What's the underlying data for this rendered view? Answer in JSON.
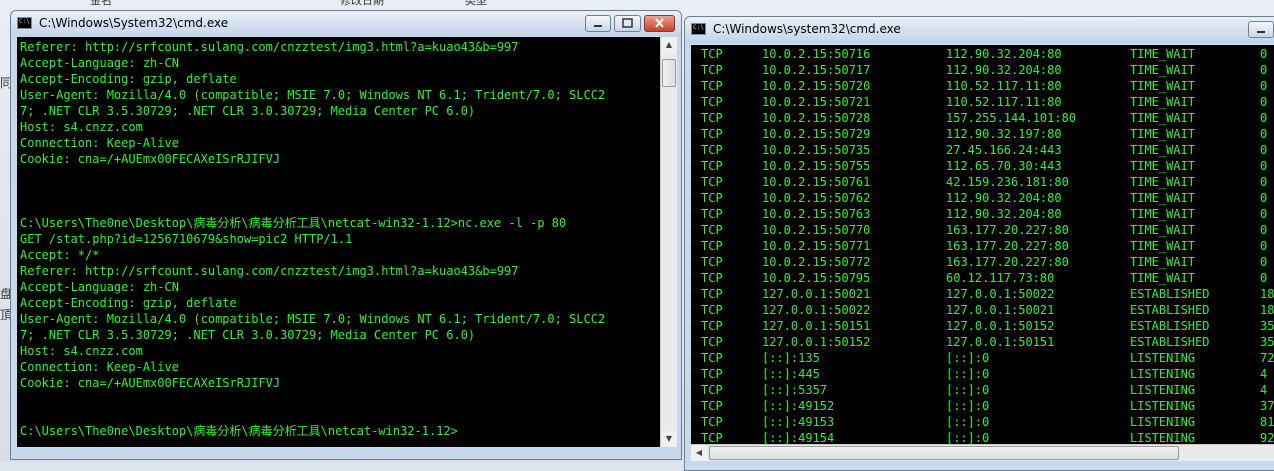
{
  "background": {
    "left_edge_chars": [
      "同",
      "盘",
      "頂"
    ],
    "top_fragments": [
      "金名",
      "修改日期",
      "类型"
    ]
  },
  "window_left": {
    "title": "C:\\Windows\\System32\\cmd.exe",
    "icon_label": "C:\\",
    "lines": [
      "Referer: http://srfcount.sulang.com/cnzztest/img3.html?a=kuao43&b=997",
      "Accept-Language: zh-CN",
      "Accept-Encoding: gzip, deflate",
      "User-Agent: Mozilla/4.0 (compatible; MSIE 7.0; Windows NT 6.1; Trident/7.0; SLCC2",
      "7; .NET CLR 3.5.30729; .NET CLR 3.0.30729; Media Center PC 6.0)",
      "Host: s4.cnzz.com",
      "Connection: Keep-Alive",
      "Cookie: cna=/+AUEmx00FECAXeISrRJIFVJ",
      "",
      "",
      "",
      "C:\\Users\\The0ne\\Desktop\\病毒分析\\病毒分析工具\\netcat-win32-1.12>nc.exe -l -p 80",
      "GET /stat.php?id=1256710679&show=pic2 HTTP/1.1",
      "Accept: */*",
      "Referer: http://srfcount.sulang.com/cnzztest/img3.html?a=kuao43&b=997",
      "Accept-Language: zh-CN",
      "Accept-Encoding: gzip, deflate",
      "User-Agent: Mozilla/4.0 (compatible; MSIE 7.0; Windows NT 6.1; Trident/7.0; SLCC2",
      "7; .NET CLR 3.5.30729; .NET CLR 3.0.30729; Media Center PC 6.0)",
      "Host: s4.cnzz.com",
      "Connection: Keep-Alive",
      "Cookie: cna=/+AUEmx00FECAXeISrRJIFVJ",
      "",
      "",
      "C:\\Users\\The0ne\\Desktop\\病毒分析\\病毒分析工具\\netcat-win32-1.12>"
    ]
  },
  "window_right": {
    "title": "C:\\Windows\\system32\\cmd.exe",
    "icon_label": "C:\\",
    "rows": [
      [
        "TCP",
        "10.0.2.15:50716",
        "112.90.32.204:80",
        "TIME_WAIT",
        "0"
      ],
      [
        "TCP",
        "10.0.2.15:50717",
        "112.90.32.204:80",
        "TIME_WAIT",
        "0"
      ],
      [
        "TCP",
        "10.0.2.15:50720",
        "110.52.117.11:80",
        "TIME_WAIT",
        "0"
      ],
      [
        "TCP",
        "10.0.2.15:50721",
        "110.52.117.11:80",
        "TIME_WAIT",
        "0"
      ],
      [
        "TCP",
        "10.0.2.15:50728",
        "157.255.144.101:80",
        "TIME_WAIT",
        "0"
      ],
      [
        "TCP",
        "10.0.2.15:50729",
        "112.90.32.197:80",
        "TIME_WAIT",
        "0"
      ],
      [
        "TCP",
        "10.0.2.15:50735",
        "27.45.166.24:443",
        "TIME_WAIT",
        "0"
      ],
      [
        "TCP",
        "10.0.2.15:50755",
        "112.65.70.30:443",
        "TIME_WAIT",
        "0"
      ],
      [
        "TCP",
        "10.0.2.15:50761",
        "42.159.236.181:80",
        "TIME_WAIT",
        "0"
      ],
      [
        "TCP",
        "10.0.2.15:50762",
        "112.90.32.204:80",
        "TIME_WAIT",
        "0"
      ],
      [
        "TCP",
        "10.0.2.15:50763",
        "112.90.32.204:80",
        "TIME_WAIT",
        "0"
      ],
      [
        "TCP",
        "10.0.2.15:50770",
        "163.177.20.227:80",
        "TIME_WAIT",
        "0"
      ],
      [
        "TCP",
        "10.0.2.15:50771",
        "163.177.20.227:80",
        "TIME_WAIT",
        "0"
      ],
      [
        "TCP",
        "10.0.2.15:50772",
        "163.177.20.227:80",
        "TIME_WAIT",
        "0"
      ],
      [
        "TCP",
        "10.0.2.15:50795",
        "60.12.117.73:80",
        "TIME_WAIT",
        "0"
      ],
      [
        "TCP",
        "127.0.0.1:50021",
        "127.0.0.1:50022",
        "ESTABLISHED",
        "18"
      ],
      [
        "TCP",
        "127.0.0.1:50022",
        "127.0.0.1:50021",
        "ESTABLISHED",
        "18"
      ],
      [
        "TCP",
        "127.0.0.1:50151",
        "127.0.0.1:50152",
        "ESTABLISHED",
        "35"
      ],
      [
        "TCP",
        "127.0.0.1:50152",
        "127.0.0.1:50151",
        "ESTABLISHED",
        "35"
      ],
      [
        "TCP",
        "[::]:135",
        "[::]:0",
        "LISTENING",
        "72"
      ],
      [
        "TCP",
        "[::]:445",
        "[::]:0",
        "LISTENING",
        "4"
      ],
      [
        "TCP",
        "[::]:5357",
        "[::]:0",
        "LISTENING",
        "4"
      ],
      [
        "TCP",
        "[::]:49152",
        "[::]:0",
        "LISTENING",
        "37"
      ],
      [
        "TCP",
        "[::]:49153",
        "[::]:0",
        "LISTENING",
        "81"
      ],
      [
        "TCP",
        "[::]:49154",
        "[::]:0",
        "LISTENING",
        "92"
      ]
    ]
  },
  "colors": {
    "console_text": "#30f030",
    "console_bg": "#000000",
    "titlebar": "#c2d3e8",
    "close_button": "#c7412a"
  },
  "icons": [
    "cmd-icon",
    "minimize-icon",
    "maximize-icon",
    "close-icon",
    "scroll-up-arrow-icon",
    "scroll-down-arrow-icon",
    "scroll-left-arrow-icon",
    "scroll-right-arrow-icon"
  ]
}
